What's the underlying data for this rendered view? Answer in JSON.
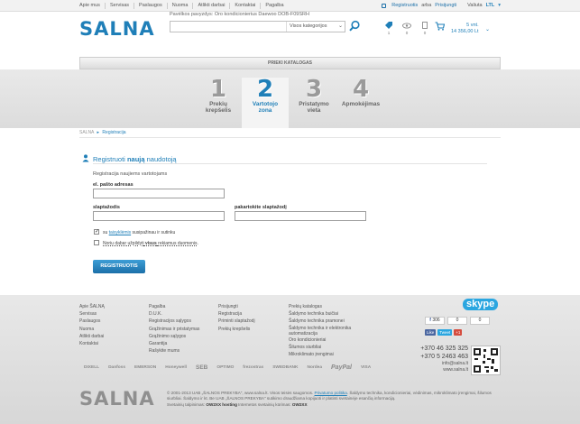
{
  "topbar": {
    "nav": [
      "Apie mus",
      "Servisas",
      "Paslaugos",
      "Nuoma",
      "Atlikti darbai",
      "Kontaktai",
      "Pagalba"
    ],
    "register": "Registruotis",
    "or": "arba",
    "login": "Prisijungti",
    "currency_label": "Valiuta",
    "currency_value": "LTL"
  },
  "header": {
    "logo": "SALNA",
    "promo": "Pavėlkos pavyzdys: Oro kondicionierius Daewoo DOB-F09SRH",
    "search_placeholder": "",
    "category_select": "Visos kategorijos",
    "counts": [
      "1",
      "0",
      "0"
    ],
    "cart_line1": "5 vnt.",
    "cart_line2": "14 356,00 Lt"
  },
  "catalog_bar": "PRIEKI KATALOGAS",
  "steps": [
    {
      "num": "1",
      "label1": "Prekių",
      "label2": "krepšelis"
    },
    {
      "num": "2",
      "label1": "Vartotojo",
      "label2": "zona"
    },
    {
      "num": "3",
      "label1": "Pristatymo",
      "label2": "vieta"
    },
    {
      "num": "4",
      "label1": "Apmokėjimas",
      "label2": ""
    }
  ],
  "breadcrumb": {
    "home": "SALNA",
    "current": "Registracija"
  },
  "form": {
    "title_pre": "Registruoti",
    "title_bold": "naują",
    "title_post": "naudotoją",
    "subtitle": "Registracija naujiems vartotojams",
    "email_label": "el. pašto adresas",
    "password_label": "slaptažodis",
    "password_repeat_label": "pakartokite slaptažodį",
    "terms_pre": "su",
    "terms_link": "taisyklėmis",
    "terms_post": "susipažinau ir sutinku",
    "news_pre": "Noriu dabar užpildyti",
    "news_bold": "visus",
    "news_post": "rekiamus duomenis.",
    "submit": "REGISTRUOTIS"
  },
  "footer": {
    "col1": [
      "Apie ŠALNĄ",
      "Servisas",
      "Paslaugos",
      "Nuoma",
      "Atlikti darbai",
      "Kontaktai"
    ],
    "col2": [
      "Pagalba",
      "D.U.K.",
      "Registracijos sąlygos",
      "Grąžinimas ir pristatymas",
      "Grąžinimo sąlygos",
      "Garantija",
      "Rašykite mums"
    ],
    "col3": [
      "Prisijungti",
      "Registracija",
      "Priminti slaptažodį",
      "Prekių krepšelis"
    ],
    "col4": [
      "Prekių katalogas",
      "Šaldymo technika buičiai",
      "Šaldymo technika pramonei",
      "Šaldymo technika ir elektronika",
      "automatizacija",
      "Oro kondicionieriai",
      "Šilumos siurbliai",
      "Mikroklimato įrengimai"
    ],
    "skype": "skype",
    "social_counts": [
      "306",
      "0",
      "0"
    ],
    "like": "Like",
    "tweet": "Tweet",
    "gplus": "+1",
    "phone1": "+370 46 325 325",
    "phone2": "+370 5 2463 463",
    "email": "info@salna.lt",
    "site": "www.salna.lt",
    "partners": [
      "DIXELL",
      "Danfoss",
      "EMERSON",
      "Honeywell",
      "SEB",
      "OPTIMO",
      "frezostras",
      "SWEDBANK",
      "Nordea",
      "PayPal",
      "VISA"
    ],
    "logo": "SALNA",
    "copyright": "© 2001-2013 UAB „ŠALNOS PREKYBA\", www.salna.lt. Visos teisės saugomos.",
    "privacy_link": "Privatumo politika",
    "copyright2": "Šaldymo technika, kondicionieriai, vėdinimas, mikroklimato įrengimai, šilumos siurbliai. Šaldymo ir kt. Be UAB „ŠALNOS PREKYBA\" sutikimo draudžiama kopijuoti ir platinti svetainėje esančią informaciją.",
    "dev_pre": "Svetainių talpinimas:",
    "dev1": "OW2XX hosting",
    "dev_mid": "Internetos svetainių kūrimas:",
    "dev2": "OW2XX"
  }
}
